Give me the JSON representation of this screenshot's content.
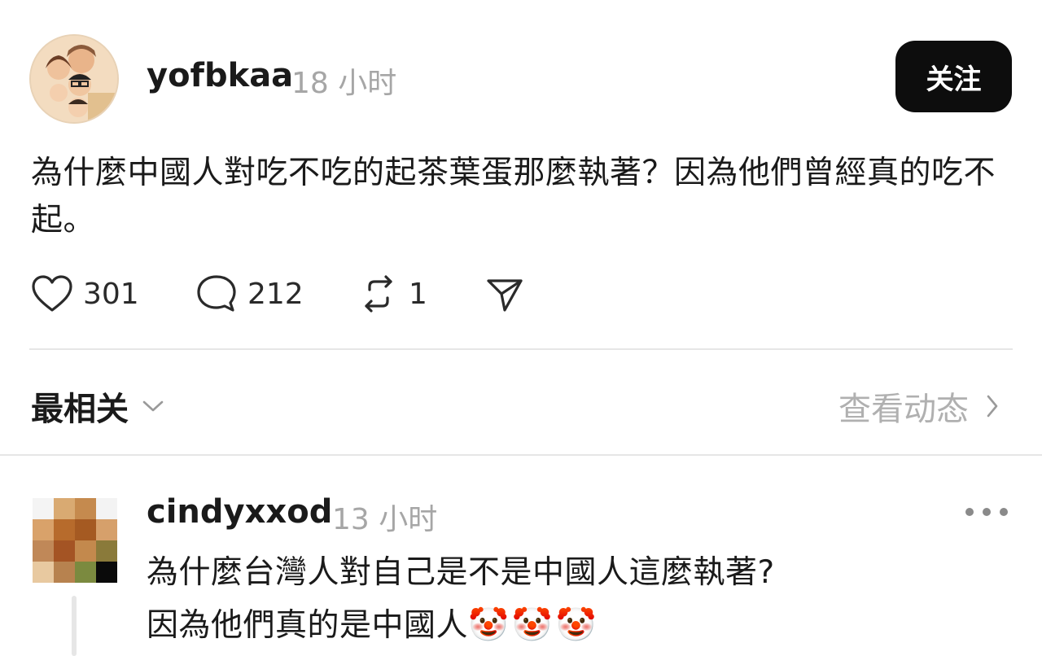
{
  "post": {
    "author": "yofbkaa",
    "time": "18 小时",
    "follow_label": "关注",
    "text": "為什麼中國人對吃不吃的起茶葉蛋那麼執著？因為他們曾經真的吃不起。",
    "likes": "301",
    "comments": "212",
    "reposts": "1",
    "icons": {
      "like": "heart-icon",
      "comment": "speech-bubble-icon",
      "repost": "repost-arrows-icon",
      "share": "send-icon"
    }
  },
  "sort": {
    "label": "最相关",
    "view_activity": "查看动态"
  },
  "comment": {
    "author": "cindyxxod",
    "time": "13 小时",
    "line1": "為什麼台灣人對自己是不是中國人這麼執著?",
    "line2": "因為他們真的是中國人",
    "emojis": "🤡🤡🤡"
  }
}
